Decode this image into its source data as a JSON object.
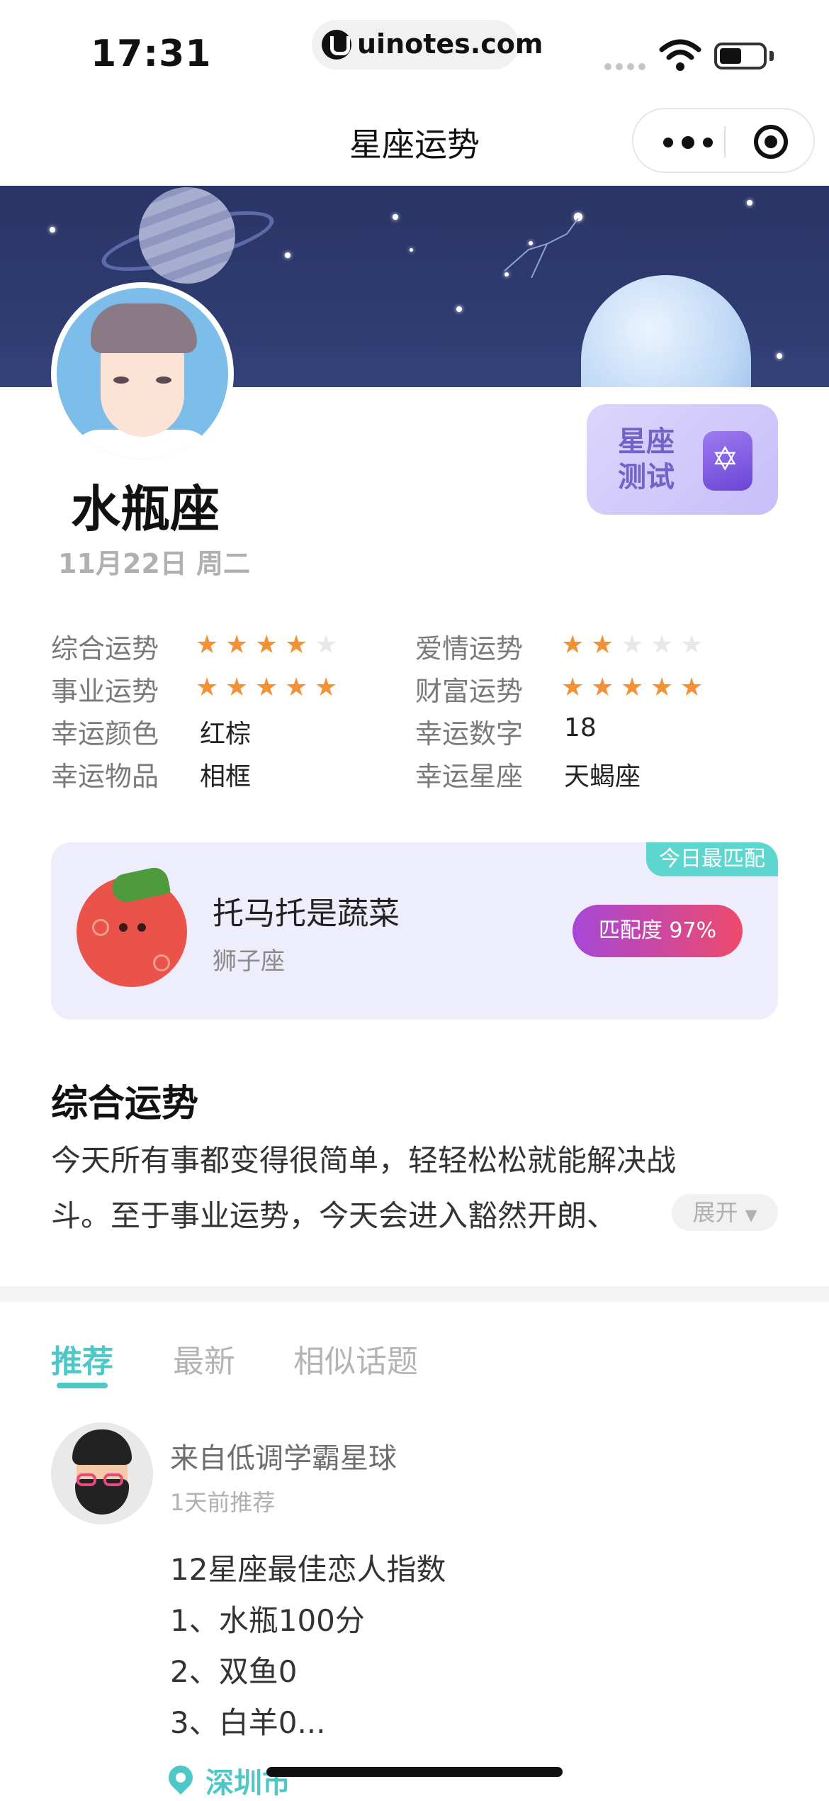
{
  "status": {
    "time": "17:31",
    "url": "uinotes.com"
  },
  "nav": {
    "title": "星座运势"
  },
  "header": {
    "sign": "水瓶座",
    "date": "11月22日 周二",
    "quiz_label": "星座测试"
  },
  "fortune": [
    {
      "label": "综合运势",
      "rating": 4
    },
    {
      "label": "爱情运势",
      "rating": 2
    },
    {
      "label": "事业运势",
      "rating": 5
    },
    {
      "label": "财富运势",
      "rating": 5
    },
    {
      "label": "幸运颜色",
      "value": "红棕"
    },
    {
      "label": "幸运数字",
      "value": "18"
    },
    {
      "label": "幸运物品",
      "value": "相框"
    },
    {
      "label": "幸运星座",
      "value": "天蝎座"
    }
  ],
  "match": {
    "tag": "今日最匹配",
    "name": "托马托是蔬菜",
    "sign": "狮子座",
    "score": "匹配度 97%"
  },
  "overall": {
    "title": "综合运势",
    "text_line1": "今天所有事都变得很简单，轻轻松松就能解决战",
    "text_line2": "斗。至于事业运势，今天会进入豁然开朗、",
    "expand": "展开"
  },
  "tabs": [
    {
      "label": "推荐"
    },
    {
      "label": "最新"
    },
    {
      "label": "相似话题"
    }
  ],
  "post": {
    "from": "来自低调学霸星球",
    "time": "1天前推荐",
    "lines": [
      "12星座最佳恋人指数",
      "1、水瓶100分",
      "2、双鱼0",
      "3、白羊0..."
    ],
    "location": "深圳市"
  },
  "colors": {
    "accent": "#4fc7c7",
    "star": "#f39235",
    "quiz": "#7363c9"
  }
}
